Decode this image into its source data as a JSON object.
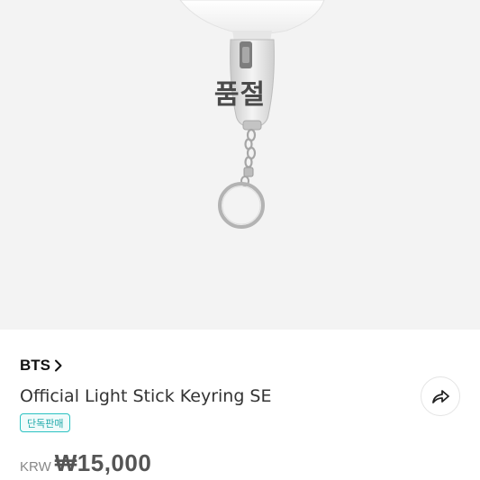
{
  "product": {
    "soldout_label": "품절",
    "brand": "BTS",
    "title": "Official Light Stick Keyring SE",
    "badge": "단독판매",
    "price_currency": "KRW",
    "price_amount": "₩15,000"
  },
  "icons": {
    "brand_chevron": "chevron-right-icon",
    "share": "share-icon"
  },
  "colors": {
    "hero_background": "#f3f3f3",
    "badge_accent": "#2bc2c2",
    "soldout_text": "#4a4a4a"
  }
}
